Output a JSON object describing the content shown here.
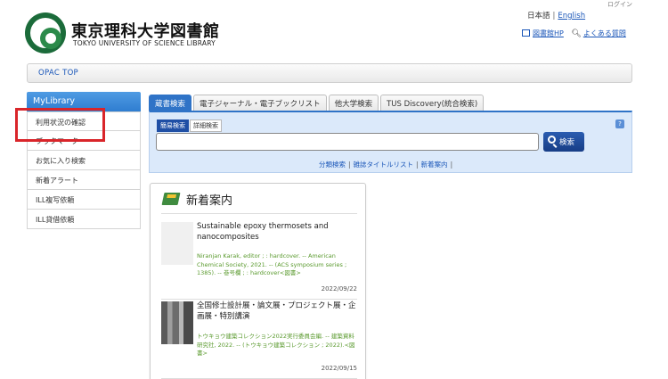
{
  "header": {
    "login": "ログイン",
    "lang_ja": "日本語",
    "lang_sep": "|",
    "lang_en": "English",
    "link_hp": "図書館HP",
    "link_faq": "よくある質問",
    "library_name_jp": "東京理科大学図書館",
    "library_name_en": "TOKYO UNIVERSITY OF SCIENCE LIBRARY"
  },
  "topbar": {
    "label": "OPAC TOP"
  },
  "sidebar": {
    "title": "MyLibrary",
    "items": [
      {
        "label": "利用状況の確認"
      },
      {
        "label": "ブックマーク"
      },
      {
        "label": "お気に入り検索"
      },
      {
        "label": "新着アラート"
      },
      {
        "label": "ILL複写依頼"
      },
      {
        "label": "ILL貸借依頼"
      }
    ]
  },
  "tabs": [
    {
      "label": "蔵書検索"
    },
    {
      "label": "電子ジャーナル・電子ブックリスト"
    },
    {
      "label": "他大学検索"
    },
    {
      "label": "TUS Discovery(統合検索)"
    }
  ],
  "search": {
    "simple_tab": "簡易検索",
    "advanced_tab": "詳細検索",
    "help": "?",
    "input_value": "",
    "button": "検索",
    "links": [
      "分類検索",
      "雑誌タイトルリスト",
      "新着案内"
    ],
    "link_sep": "|"
  },
  "new_arrivals": {
    "title": "新着案内",
    "items": [
      {
        "title": "Sustainable epoxy thermosets and nanocomposites",
        "meta": "Niranjan Karak, editor ; : hardcover. -- American Chemical Society, 2021. -- (ACS symposium series ; 1385). -- 巻号欄 ; : hardcover<図書>",
        "date": "2022/09/22"
      },
      {
        "title": "全国修士設計展・論文展・プロジェクト展・企画展・特別講演",
        "meta": "トウキョウ建築コレクション2022実行委員会編. -- 建築資料研究社, 2022. -- (トウキョウ建築コレクション ; 2022).<図書>",
        "date": "2022/09/15"
      }
    ]
  }
}
